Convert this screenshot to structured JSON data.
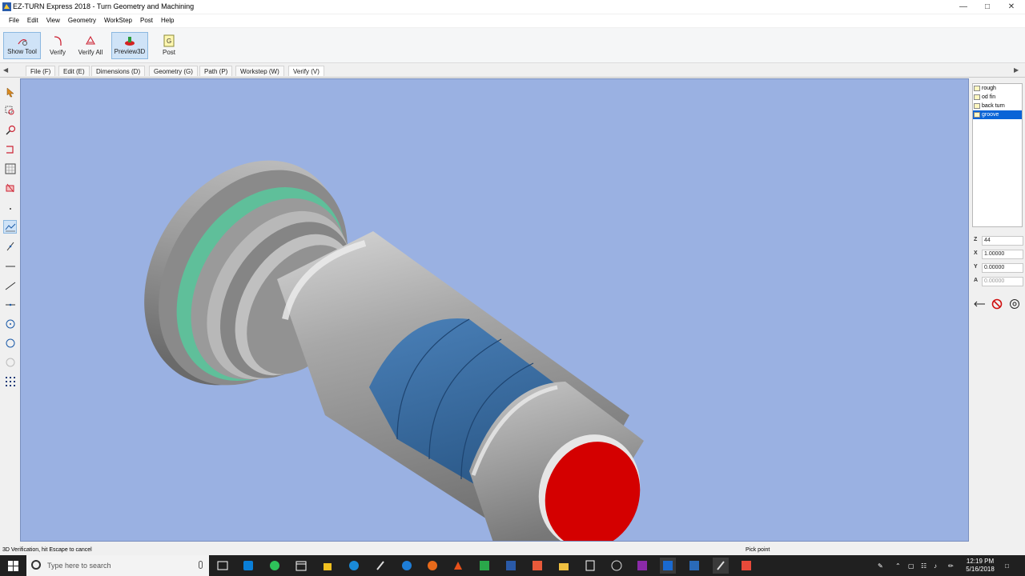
{
  "window": {
    "title": "EZ-TURN Express 2018 - Turn Geometry and Machining",
    "controls": [
      "minimize-icon",
      "maximize-icon",
      "close-icon"
    ]
  },
  "menu": [
    "File",
    "Edit",
    "View",
    "Geometry",
    "WorkStep",
    "Post",
    "Help"
  ],
  "toolbar": {
    "buttons": [
      {
        "label": "Show Tool",
        "icon": "show-tool-icon"
      },
      {
        "label": "Verify",
        "icon": "verify-icon"
      },
      {
        "label": "Verify All",
        "icon": "verify-all-icon"
      },
      {
        "label": "Preview3D",
        "icon": "preview3d-icon",
        "active": true
      },
      {
        "label": "Post",
        "icon": "post-icon"
      }
    ]
  },
  "tabs": [
    "File (F)",
    "Edit (E)",
    "Dimensions (D)",
    "Geometry (G)",
    "Path (P)",
    "Workstep (W)",
    "Verify (V)"
  ],
  "operations": [
    {
      "label": "rough",
      "selected": false
    },
    {
      "label": "od fin",
      "selected": false
    },
    {
      "label": "back turn",
      "selected": false
    },
    {
      "label": "groove",
      "selected": true
    }
  ],
  "coords": [
    {
      "axis": "Z",
      "value": "44"
    },
    {
      "axis": "X",
      "value": "1.00000"
    },
    {
      "axis": "Y",
      "value": "0.00000"
    },
    {
      "axis": "A",
      "value": "0.00000"
    }
  ],
  "status": {
    "left": "3D Verification, hit Escape to cancel",
    "right": "Pick point"
  },
  "taskbar": {
    "search_placeholder": "Type here to search",
    "clock_time": "12:19 PM",
    "clock_date": "5/16/2018"
  },
  "colors": {
    "viewport_bg": "#9ab1e2",
    "part_gray": "#9a9a9a",
    "groove_green": "#5fbf9a",
    "cut_blue": "#3a6fa8",
    "face_red": "#d40000",
    "selection": "#0a64d7"
  }
}
